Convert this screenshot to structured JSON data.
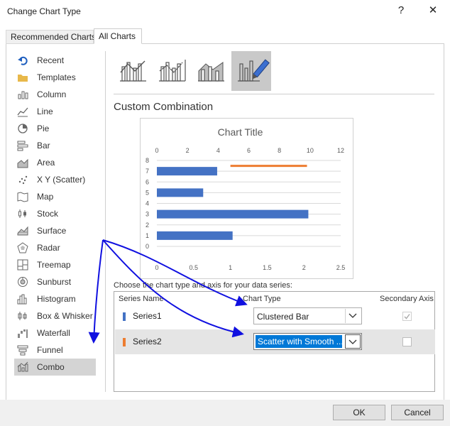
{
  "window": {
    "title": "Change Chart Type",
    "help_label": "?",
    "close_label": "✕"
  },
  "tabs": [
    {
      "label": "Recommended Charts",
      "active": false
    },
    {
      "label": "All Charts",
      "active": true
    }
  ],
  "sidebar": {
    "items": [
      {
        "label": "Recent",
        "icon": "undo-icon"
      },
      {
        "label": "Templates",
        "icon": "folder-icon"
      },
      {
        "label": "Column",
        "icon": "column-chart-icon"
      },
      {
        "label": "Line",
        "icon": "line-chart-icon"
      },
      {
        "label": "Pie",
        "icon": "pie-chart-icon"
      },
      {
        "label": "Bar",
        "icon": "bar-chart-icon"
      },
      {
        "label": "Area",
        "icon": "area-chart-icon"
      },
      {
        "label": "X Y (Scatter)",
        "icon": "scatter-chart-icon"
      },
      {
        "label": "Map",
        "icon": "map-icon"
      },
      {
        "label": "Stock",
        "icon": "stock-chart-icon"
      },
      {
        "label": "Surface",
        "icon": "surface-chart-icon"
      },
      {
        "label": "Radar",
        "icon": "radar-chart-icon"
      },
      {
        "label": "Treemap",
        "icon": "treemap-icon"
      },
      {
        "label": "Sunburst",
        "icon": "sunburst-icon"
      },
      {
        "label": "Histogram",
        "icon": "histogram-icon"
      },
      {
        "label": "Box & Whisker",
        "icon": "box-whisker-icon"
      },
      {
        "label": "Waterfall",
        "icon": "waterfall-icon"
      },
      {
        "label": "Funnel",
        "icon": "funnel-icon"
      },
      {
        "label": "Combo",
        "icon": "combo-chart-icon",
        "selected": true
      }
    ]
  },
  "combo_subtypes": [
    {
      "icon": "clustered-column-line-icon"
    },
    {
      "icon": "clustered-column-line-secondary-icon"
    },
    {
      "icon": "stacked-area-column-icon"
    },
    {
      "icon": "custom-combination-icon",
      "selected": true
    }
  ],
  "section_title": "Custom Combination",
  "chart_data": {
    "type": "bar",
    "title": "Chart Title",
    "categories": [
      "1",
      "3",
      "5",
      "7"
    ],
    "series": [
      {
        "name": "Series1",
        "values": [
          1.03,
          2.06,
          0.63,
          0.82
        ],
        "color": "#4472c4"
      }
    ],
    "xlim": [
      0,
      2.5
    ],
    "x_ticks": [
      "0",
      "0.5",
      "1",
      "1.5",
      "2",
      "2.5"
    ],
    "ylim": [
      0,
      8
    ],
    "y_ticks": [
      "0",
      "1",
      "2",
      "3",
      "4",
      "5",
      "6",
      "7",
      "8"
    ],
    "secondary_xlim": [
      0,
      12
    ],
    "secondary_x_ticks": [
      "0",
      "2",
      "4",
      "6",
      "8",
      "10",
      "12"
    ],
    "secondary_line": {
      "x": [
        4.8,
        9.8
      ],
      "y": [
        7.5,
        7.5
      ],
      "color": "#ed7d31"
    },
    "grid": true
  },
  "series_table": {
    "prompt": "Choose the chart type and axis for your data series:",
    "headers": {
      "name": "Series Name",
      "type": "Chart Type",
      "axis": "Secondary Axis"
    },
    "rows": [
      {
        "name": "Series1",
        "color": "#4472c4",
        "type": "Clustered Bar",
        "secondary": true,
        "secondary_enabled": false
      },
      {
        "name": "Series2",
        "color": "#ed7d31",
        "type": "Scatter with Smooth ...",
        "secondary": false,
        "selected": true
      }
    ]
  },
  "buttons": {
    "ok": "OK",
    "cancel": "Cancel"
  },
  "annotation_color": "#1010e0"
}
